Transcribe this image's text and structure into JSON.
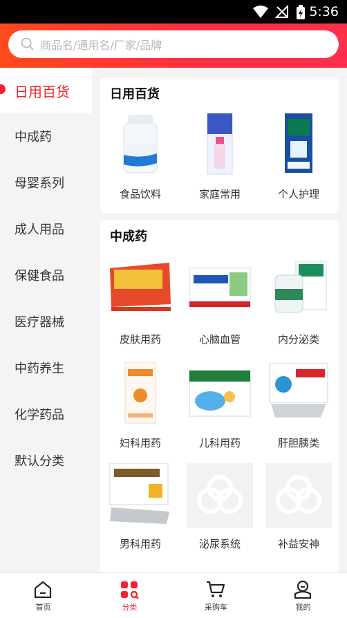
{
  "status_bar": {
    "time": "5:36"
  },
  "search": {
    "placeholder": "商品名/通用名/厂家/品牌"
  },
  "sidebar": {
    "items": [
      {
        "label": "日用百货",
        "active": true
      },
      {
        "label": "中成药"
      },
      {
        "label": "母婴系列"
      },
      {
        "label": "成人用品"
      },
      {
        "label": "保健食品"
      },
      {
        "label": "医疗器械"
      },
      {
        "label": "中药养生"
      },
      {
        "label": "化学药品"
      },
      {
        "label": "默认分类"
      }
    ]
  },
  "sections": [
    {
      "title": "日用百货",
      "items": [
        {
          "label": "食品饮料"
        },
        {
          "label": "家庭常用"
        },
        {
          "label": "个人护理"
        }
      ]
    },
    {
      "title": "中成药",
      "items": [
        {
          "label": "皮肤用药"
        },
        {
          "label": "心脑血管"
        },
        {
          "label": "内分泌类"
        },
        {
          "label": "妇科用药"
        },
        {
          "label": "儿科用药"
        },
        {
          "label": "肝胆胰类"
        },
        {
          "label": "男科用药"
        },
        {
          "label": "泌尿系统"
        },
        {
          "label": "补益安神"
        }
      ]
    }
  ],
  "tabbar": {
    "items": [
      {
        "label": "首页",
        "icon": "home-icon"
      },
      {
        "label": "分类",
        "icon": "category-icon",
        "active": true
      },
      {
        "label": "采购车",
        "icon": "cart-icon"
      },
      {
        "label": "我的",
        "icon": "profile-icon"
      }
    ]
  },
  "colors": {
    "accent": "#f5222d",
    "header_start": "#ff4a1c",
    "header_end": "#ff2e4c"
  }
}
